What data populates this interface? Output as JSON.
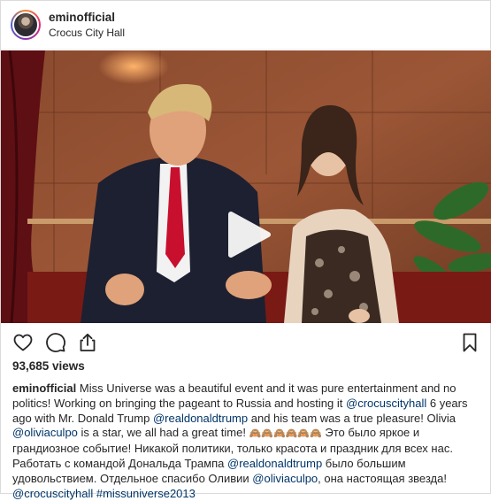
{
  "header": {
    "username": "eminofficial",
    "location": "Crocus City Hall",
    "avatar_icon": "profile-avatar"
  },
  "video": {
    "play_icon": "play-icon",
    "tag_icon": "user-tag-icon"
  },
  "actions": {
    "like_icon": "heart-icon",
    "comment_icon": "comment-icon",
    "share_icon": "share-icon",
    "save_icon": "bookmark-icon"
  },
  "stats": {
    "views": "93,685 views"
  },
  "caption": {
    "username": "eminofficial",
    "part1": " Miss Universe was a beautiful event and it was pure entertainment and no politics! Working on bringing the pageant to Russia and hosting it ",
    "mention1": "@crocuscityhall",
    "part2": " 6 years ago with Mr. Donald Trump ",
    "mention2": "@realdonaldtrump",
    "part3": " and his team was a true pleasure! Olivia ",
    "mention3": "@oliviaculpo",
    "part4": " is a star, we all had a great time! ",
    "emoji": "🙈🙈🙈🙈🙈🙈",
    "part5": " Это было яркое и грандиозное событие! Никакой политики, только красота и праздник для всех нас. Работать с командой Дональда Трампа ",
    "mention4": "@realdonaldtrump",
    "part6": " было большим удовольствием. Отдельное спасибо Оливии ",
    "mention5": "@oliviaculpo",
    "part7": ", она настоящая звезда! ",
    "mention6": "@crocuscityhall",
    "space": " ",
    "hashtag": "#missuniverse2013"
  }
}
